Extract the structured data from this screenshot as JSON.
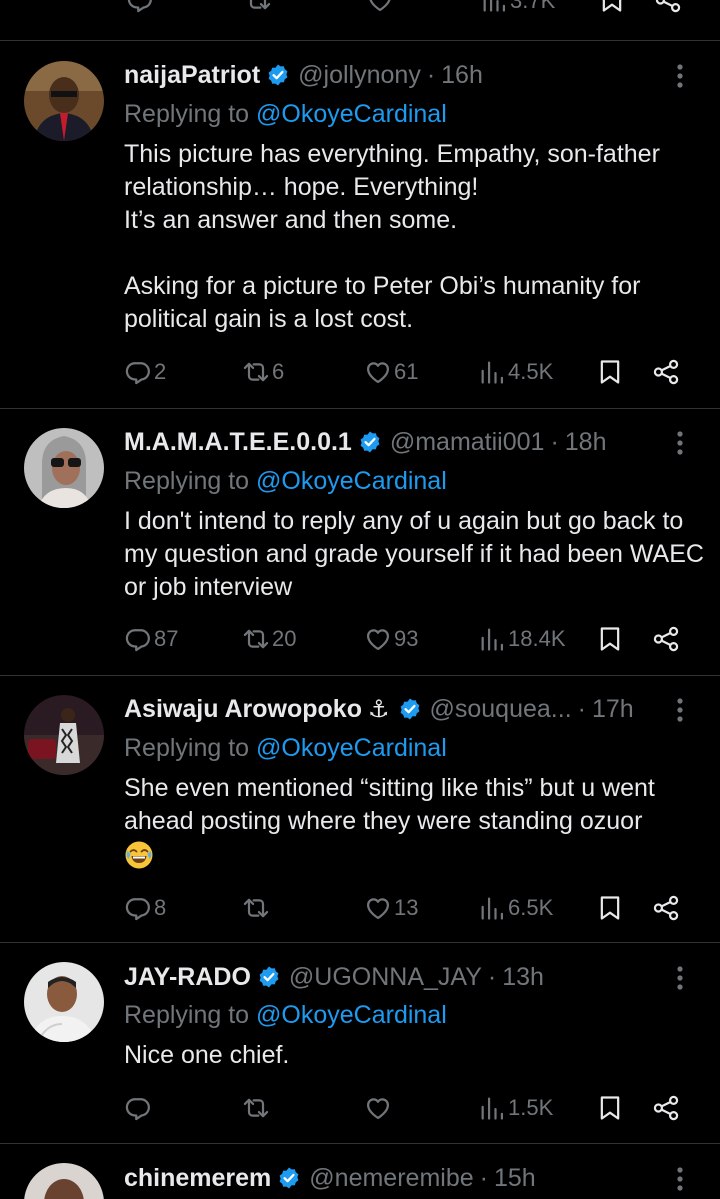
{
  "prev_tweet": {
    "views_partial": "3.7K"
  },
  "tweets": [
    {
      "name": "naijaPatriot",
      "handle": "@jollynony",
      "time": "16h",
      "replying_prefix": "Replying to ",
      "replying_to": "@OkoyeCardinal",
      "text": "This picture has everything. Empathy, son-father relationship… hope. Everything!\nIt’s an answer and then some.\n\nAsking for a picture to  Peter Obi’s humanity for political gain is a lost cost.",
      "replies": "2",
      "reposts": "6",
      "likes": "61",
      "views": "4.5K"
    },
    {
      "name": "M.A.M.A.T.E.E.0.0.1",
      "handle": "@mamatii001",
      "time": "18h",
      "replying_prefix": "Replying to ",
      "replying_to": "@OkoyeCardinal",
      "text": "I don't intend to reply any of u again but go back to my question and grade yourself if it had been WAEC or job interview",
      "replies": "87",
      "reposts": "20",
      "likes": "93",
      "views": "18.4K"
    },
    {
      "name": "Asiwaju Arowopoko",
      "name_suffix": "⚓",
      "handle": "@souquea...",
      "time": "17h",
      "replying_prefix": "Replying to ",
      "replying_to": "@OkoyeCardinal",
      "text": "She even mentioned “sitting like this” but u went ahead posting where they were standing ozuor",
      "emoji": "face-with-tears-of-joy",
      "replies": "8",
      "reposts": "",
      "likes": "13",
      "views": "6.5K"
    },
    {
      "name": "JAY-RADO",
      "handle": "@UGONNA_JAY",
      "time": "13h",
      "replying_prefix": "Replying to ",
      "replying_to": "@OkoyeCardinal",
      "text": "Nice one chief.",
      "replies": "",
      "reposts": "",
      "likes": "",
      "views": "1.5K"
    },
    {
      "name": "chinemerem",
      "handle": "@nemeremibe",
      "time": "15h"
    }
  ],
  "separator": "·",
  "colors": {
    "background": "#000000",
    "text": "#e7e9ea",
    "muted": "#71767b",
    "accent": "#1d9bf0",
    "divider": "#2f3336"
  },
  "icons": {
    "reply": "reply-icon",
    "repost": "repost-icon",
    "like": "heart-icon",
    "views": "views-icon",
    "bookmark": "bookmark-icon",
    "share": "share-icon",
    "more": "more-vertical-icon",
    "verified": "verified-badge-icon"
  }
}
